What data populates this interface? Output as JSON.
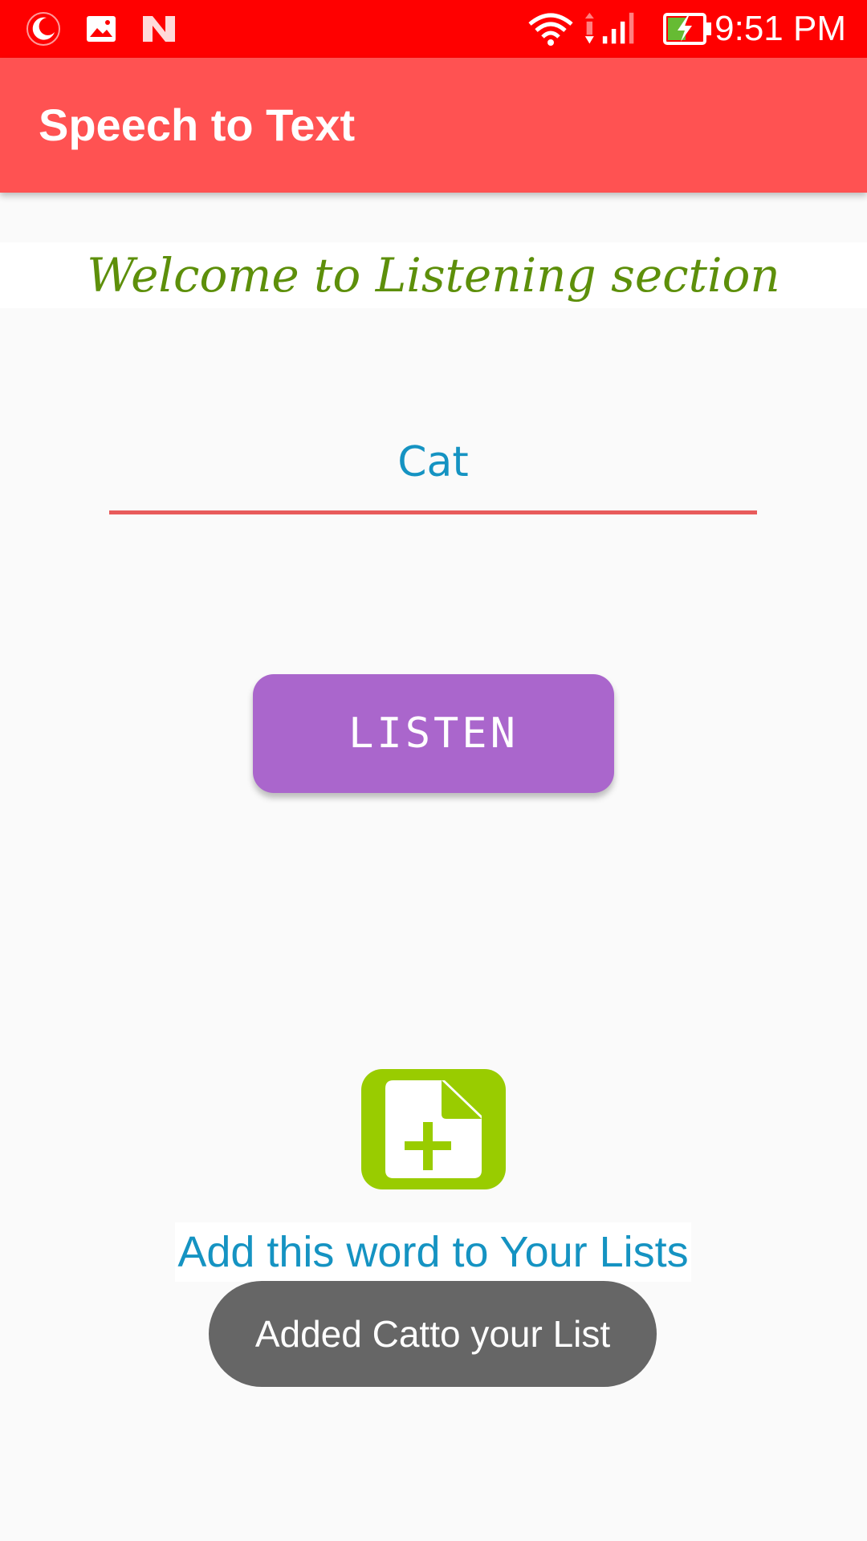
{
  "status_bar": {
    "time": "9:51 PM",
    "icons": [
      "do-not-disturb-icon",
      "image-icon",
      "n-logo-icon",
      "wifi-icon",
      "signal-icon",
      "battery-charging-icon"
    ],
    "background_color": "#ff0000"
  },
  "app_bar": {
    "title": "Speech to Text",
    "background_color": "#ff5252"
  },
  "main": {
    "welcome_text": "Welcome to Listening section",
    "word_value": "Cat",
    "listen_button_label": "LISTEN",
    "add_icon": "add-document-icon",
    "add_text": "Add this word to Your Lists"
  },
  "toast": {
    "message": "Added Catto your List"
  },
  "colors": {
    "accent_purple": "#aa66cc",
    "text_blue": "#1593c2",
    "welcome_green": "#5d8f0a",
    "icon_green": "#99cc00",
    "underline_red": "#e85b5b"
  }
}
